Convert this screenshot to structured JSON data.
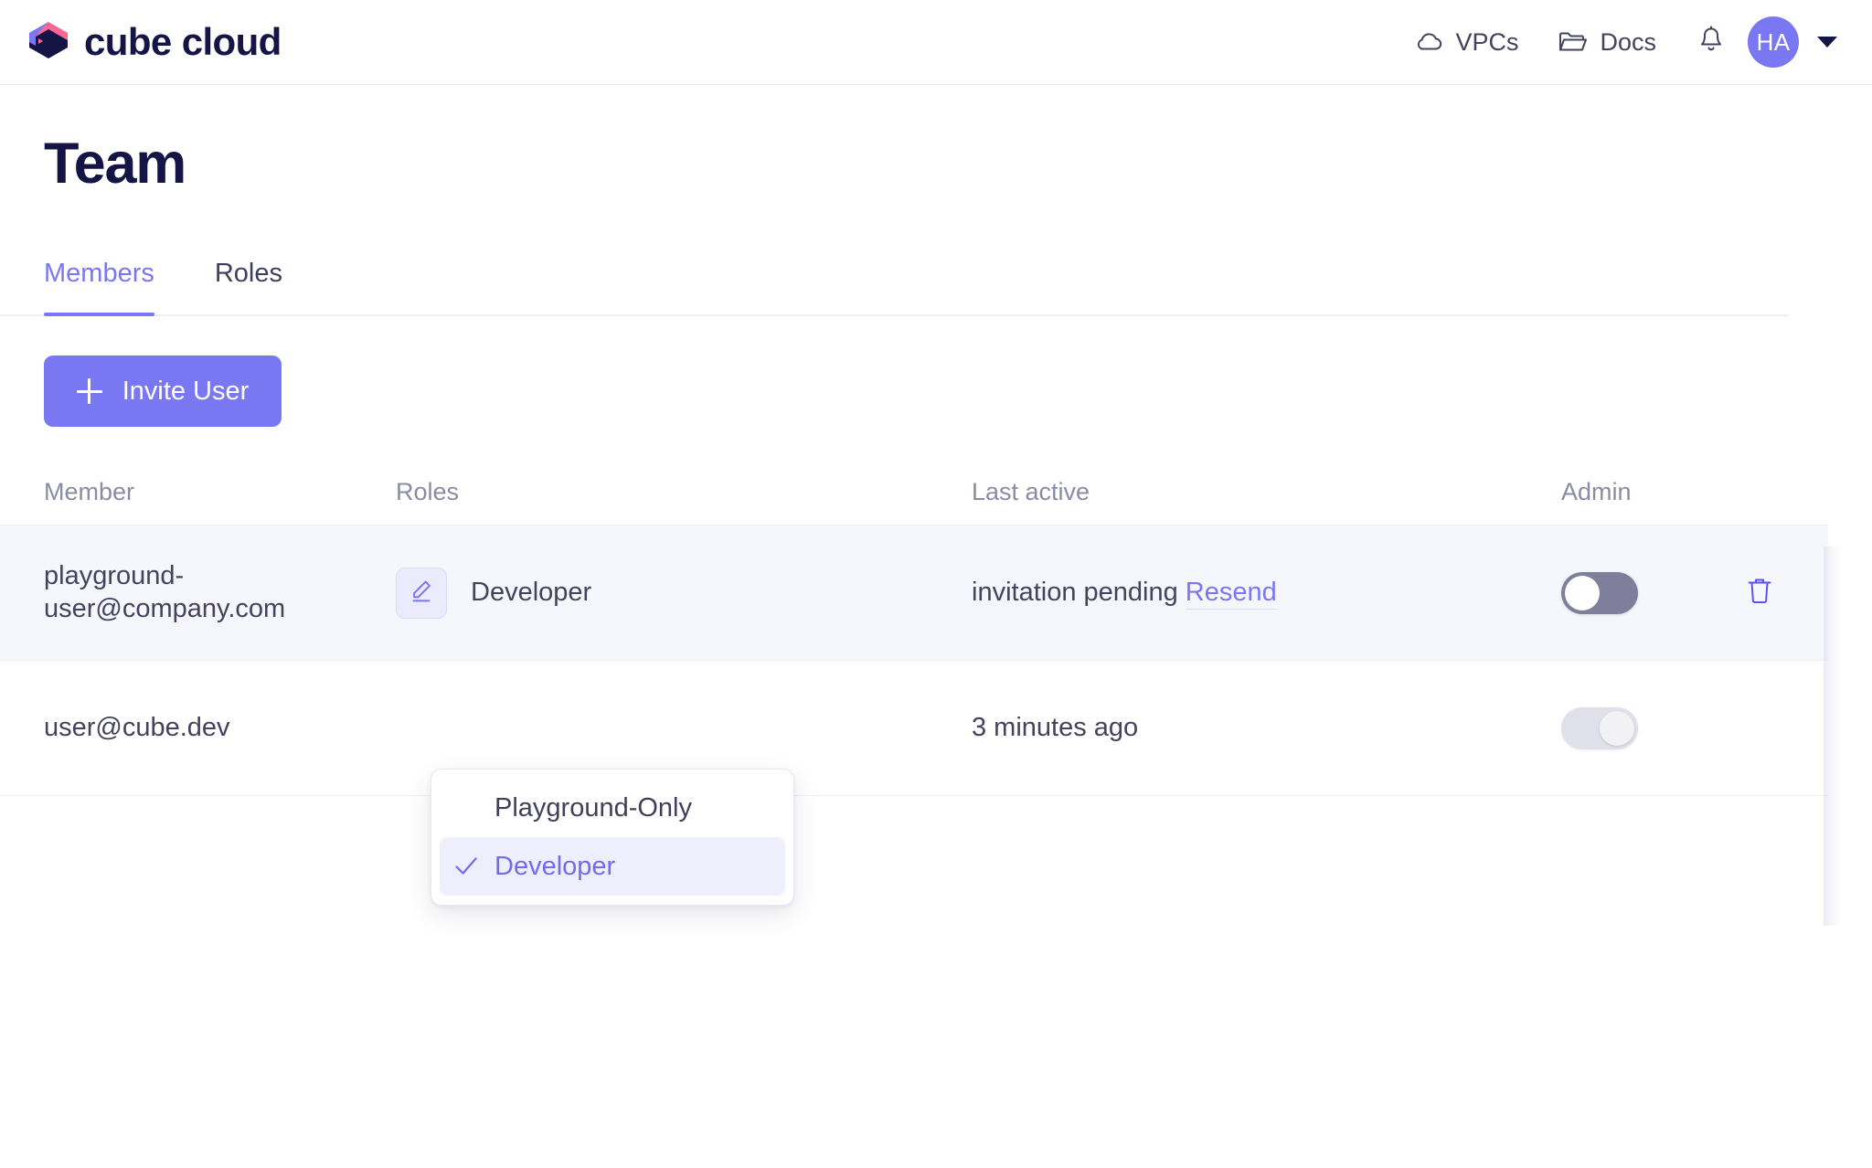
{
  "header": {
    "brand_name": "cube cloud",
    "logo_icon": "cube-logo-icon",
    "nav": [
      {
        "label": "VPCs",
        "icon": "cloud-icon"
      },
      {
        "label": "Docs",
        "icon": "folder-icon"
      }
    ],
    "notifications_icon": "bell-icon",
    "avatar_initials": "HA",
    "account_caret_icon": "chevron-down-icon"
  },
  "page": {
    "title": "Team"
  },
  "tabs": [
    {
      "label": "Members",
      "active": true
    },
    {
      "label": "Roles",
      "active": false
    }
  ],
  "toolbar": {
    "invite_label": "Invite User",
    "invite_icon": "plus-icon"
  },
  "table": {
    "columns": [
      {
        "label": "Member"
      },
      {
        "label": "Roles"
      },
      {
        "label": "Last active"
      },
      {
        "label": "Admin"
      }
    ],
    "rows": [
      {
        "member": "playground-user@company.com",
        "role": "Developer",
        "edit_icon": "pencil-icon",
        "last_active": "invitation pending",
        "resend_label": "Resend",
        "admin_toggle": "off",
        "delete_icon": "trash-icon"
      },
      {
        "member": "user@cube.dev",
        "role": "Developer",
        "last_active": "3 minutes ago",
        "admin_toggle": "on"
      }
    ]
  },
  "role_dropdown": {
    "items": [
      {
        "label": "Playground-Only",
        "selected": false
      },
      {
        "label": "Developer",
        "selected": true,
        "check_icon": "check-icon"
      }
    ]
  },
  "colors": {
    "accent": "#7a77f2",
    "brand_dark": "#141446",
    "brand_pink": "#ff6492",
    "text": "#43435e",
    "muted": "#8b8ba3",
    "row_highlight": "#f6f7fc"
  }
}
